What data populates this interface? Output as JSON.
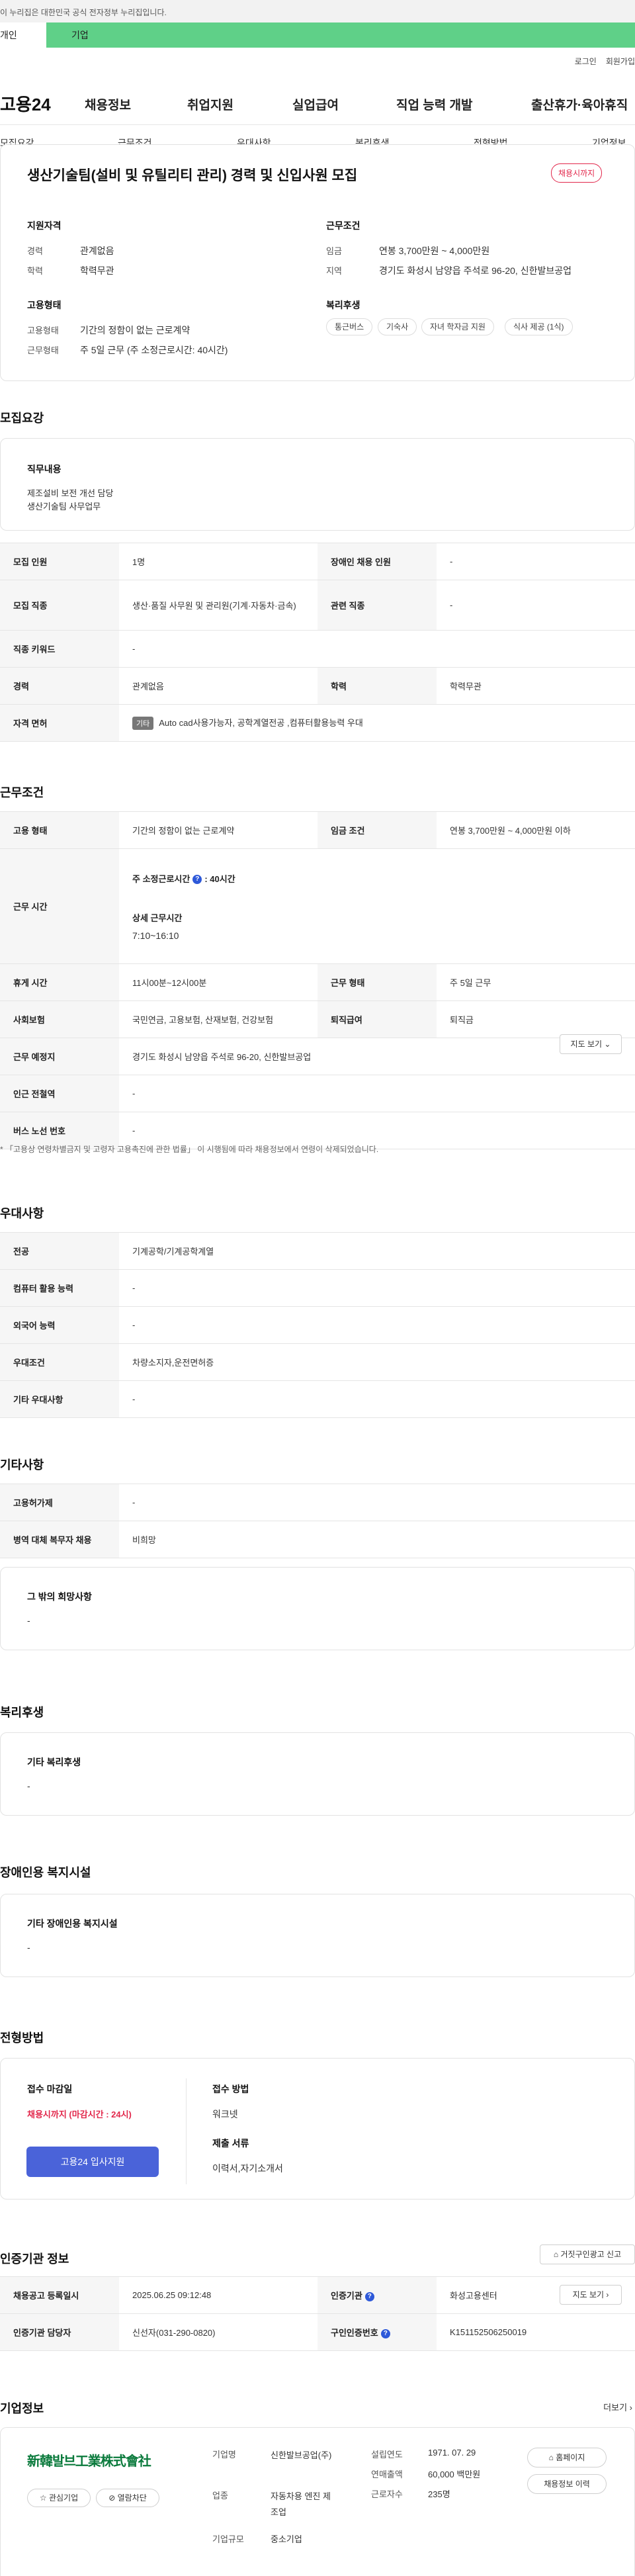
{
  "gov_notice": "이 누리집은 대한민국 공식 전자정부 누리집입니다.",
  "user_tabs": {
    "individual": "개인",
    "company": "기업"
  },
  "top_links": {
    "login": "로그인",
    "signup": "회원가입"
  },
  "logo": "고용24",
  "gnb": [
    "채용정보",
    "취업지원",
    "실업급여",
    "직업 능력 개발",
    "출산휴가·육아휴직"
  ],
  "snb": [
    "모집요강",
    "근무조건",
    "우대사항",
    "복리후생",
    "전형방법",
    "기업정보"
  ],
  "job": {
    "title": "생산기술팀(설비 및 유틸리티 관리) 경력 및 신입사원 모집",
    "badge": "채용시까지",
    "qual": {
      "heading": "지원자격",
      "career_label": "경력",
      "career": "관계없음",
      "edu_label": "학력",
      "edu": "학력무관"
    },
    "cond": {
      "heading": "근무조건",
      "wage_label": "임금",
      "wage": "연봉 3,700만원 ~ 4,000만원",
      "loc_label": "지역",
      "loc": "경기도 화성시 남양읍 주석로 96-20, 신한발브공업"
    },
    "emp": {
      "heading": "고용형태",
      "type_label": "고용형태",
      "type": "기간의 정함이 없는 근로계약",
      "form_label": "근무형태",
      "form": "주 5일 근무 (주 소정근로시간: 40시간)"
    },
    "welfare": {
      "heading": "복리후생",
      "chips": [
        "통근버스",
        "기숙사",
        "자녀 학자금 지원",
        "식사 제공 (1식)"
      ]
    }
  },
  "recruit": {
    "heading": "모집요강",
    "duty_heading": "직무내용",
    "duty_lines": [
      "제조설비 보전 개선 담당",
      "생산기술팀 사무업무"
    ],
    "rows": {
      "count_label": "모집 인원",
      "count": "1명",
      "disabled_label": "장애인 채용 인원",
      "disabled": "-",
      "job_label": "모집 직종",
      "job": "생산·품질 사무원 및 관리원(기계·자동차·금속)",
      "rel_label": "관련 직종",
      "rel": "-",
      "kw_label": "직종 키워드",
      "kw": "-",
      "career_label": "경력",
      "career": "관계없음",
      "edu_label": "학력",
      "edu": "학력무관",
      "lic_label": "자격 면허",
      "lic_tag": "기타",
      "lic": "Auto cad사용가능자, 공학계열전공 ,컴퓨터활용능력 우대"
    }
  },
  "work": {
    "heading": "근무조건",
    "emp_label": "고용 형태",
    "emp": "기간의 정함이 없는 근로계약",
    "wage_label": "임금 조건",
    "wage": "연봉 3,700만원 ~ 4,000만원 이하",
    "time_label": "근무 시간",
    "std_prefix": "주 소정근로시간",
    "std_suffix": "40시간",
    "detail_heading": "상세 근무시간",
    "detail": "7:10~16:10",
    "rest_label": "휴게 시간",
    "rest": "11시00분~12시00분",
    "form_label": "근무 형태",
    "form": "주 5일 근무",
    "ins_label": "사회보험",
    "ins": "국민연금, 고용보험, 산재보험, 건강보험",
    "sev_label": "퇴직급여",
    "sev": "퇴직금",
    "place_label": "근무 예정지",
    "place": "경기도 화성시 남양읍 주석로 96-20, 신한발브공업",
    "map_btn": "지도 보기",
    "subway_label": "인근 전철역",
    "subway": "-",
    "bus_label": "버스 노선 번호",
    "bus": "-",
    "note": "* 「고용상 연령차별금지 및 고령자 고용촉진에 관한 법률」 이 시행됨에 따라 채용정보에서 연령이 삭제되었습니다."
  },
  "pref": {
    "heading": "우대사항",
    "major_label": "전공",
    "major": "기계공학/기계공학계열",
    "pc_label": "컴퓨터 활용 능력",
    "pc": "-",
    "lang_label": "외국어 능력",
    "lang": "-",
    "cond_label": "우대조건",
    "cond": "차량소지자,운전면허증",
    "etc_label": "기타 우대사항",
    "etc": "-"
  },
  "other": {
    "heading": "기타사항",
    "hire_label": "고용허가제",
    "hire": "-",
    "mil_label": "병역 대체 복무자 채용",
    "mil": "비희망",
    "wish_heading": "그 밖의 희망사항",
    "wish": "-"
  },
  "benefit": {
    "heading": "복리후생",
    "sub": "기타 복리후생",
    "val": "-"
  },
  "disab": {
    "heading": "장애인용 복지시설",
    "sub": "기타 장애인용 복지시설",
    "val": "-"
  },
  "select": {
    "heading": "전형방법",
    "deadline_label": "접수 마감일",
    "deadline": "채용시까지 (마감시간 : 24시)",
    "apply_btn": "고용24 입사지원",
    "method_label": "접수 방법",
    "method": "워크넷",
    "docs_label": "제출 서류",
    "docs": "이력서,자기소개서"
  },
  "agency": {
    "heading": "인증기관 정보",
    "report_btn": "거짓구인광고 신고",
    "reg_label": "채용공고 등록일시",
    "reg": "2025.06.25 09:12:48",
    "org_label": "인증기관",
    "org": "화성고용센터",
    "map_btn": "지도 보기",
    "mgr_label": "인증기관 담당자",
    "mgr": "신선자(031-290-0820)",
    "num_label": "구인인증번호",
    "num": "K151152506250019"
  },
  "company": {
    "heading": "기업정보",
    "more": "더보기",
    "logo_text": "新韓발브工業株式會社",
    "fav_btn": "관심기업",
    "block_btn": "열람차단",
    "name_label": "기업명",
    "name": "신한발브공업(주)",
    "biz_label": "업종",
    "biz": "자동차용 엔진 제조업",
    "size_label": "기업규모",
    "size": "중소기업",
    "est_label": "설립연도",
    "est": "1971. 07. 29",
    "sales_label": "연매출액",
    "sales": "60,000 백만원",
    "emp_label": "근로자수",
    "emp": "235명",
    "home_btn": "홈페이지",
    "hist_btn": "채용정보 이력"
  }
}
